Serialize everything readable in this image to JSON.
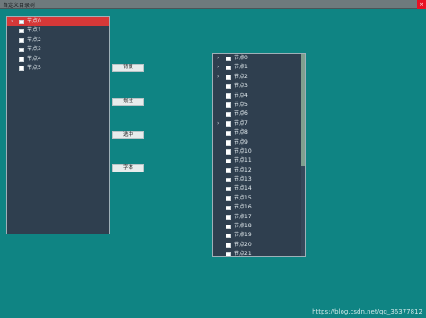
{
  "window": {
    "title": "自定义目录树",
    "close_icon": "×"
  },
  "left_tree": {
    "nodes": [
      {
        "label": "节点0",
        "arrow": "›",
        "selected": true
      },
      {
        "label": "节点1",
        "arrow": ""
      },
      {
        "label": "节点2",
        "arrow": ""
      },
      {
        "label": "节点3",
        "arrow": ""
      },
      {
        "label": "节点4",
        "arrow": ""
      },
      {
        "label": "节点5",
        "arrow": ""
      }
    ]
  },
  "buttons": {
    "background": "背景",
    "dashed": "划过",
    "select": "选中",
    "font": "字体"
  },
  "right_tree": {
    "nodes": [
      {
        "label": "节点0",
        "arrow": "›"
      },
      {
        "label": "节点1",
        "arrow": "›"
      },
      {
        "label": "节点2",
        "arrow": "›"
      },
      {
        "label": "节点3",
        "arrow": ""
      },
      {
        "label": "节点4",
        "arrow": ""
      },
      {
        "label": "节点5",
        "arrow": ""
      },
      {
        "label": "节点6",
        "arrow": ""
      },
      {
        "label": "节点7",
        "arrow": "›"
      },
      {
        "label": "节点8",
        "arrow": ""
      },
      {
        "label": "节点9",
        "arrow": ""
      },
      {
        "label": "节点10",
        "arrow": ""
      },
      {
        "label": "节点11",
        "arrow": ""
      },
      {
        "label": "节点12",
        "arrow": ""
      },
      {
        "label": "节点13",
        "arrow": ""
      },
      {
        "label": "节点14",
        "arrow": ""
      },
      {
        "label": "节点15",
        "arrow": ""
      },
      {
        "label": "节点16",
        "arrow": ""
      },
      {
        "label": "节点17",
        "arrow": ""
      },
      {
        "label": "节点18",
        "arrow": ""
      },
      {
        "label": "节点19",
        "arrow": ""
      },
      {
        "label": "节点20",
        "arrow": ""
      },
      {
        "label": "节点21",
        "arrow": ""
      }
    ]
  },
  "watermark": "https://blog.csdn.net/qq_36377812",
  "colors": {
    "background": "#0f8483",
    "tree_bg": "#2f3f4f",
    "selected": "#d63838",
    "titlebar": "#6f7a7d",
    "scrollbar_thumb": "#7fa08f"
  },
  "icons": {
    "expand": "chevron-right-icon",
    "checkbox": "checkbox-icon",
    "close": "close-icon"
  }
}
